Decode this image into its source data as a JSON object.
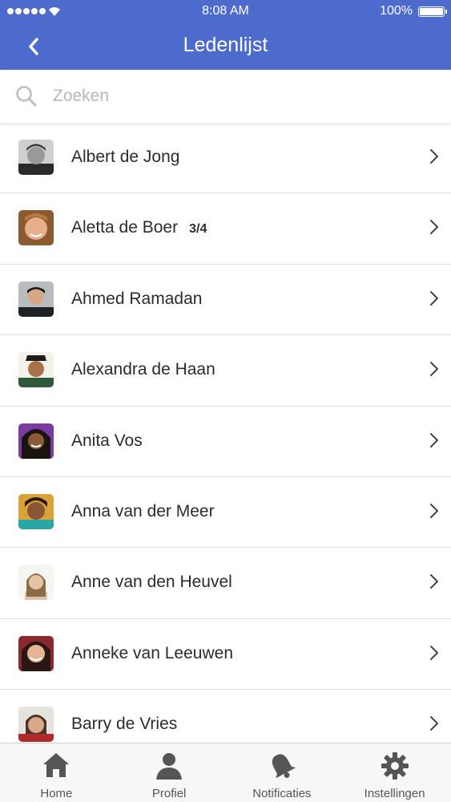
{
  "status_bar": {
    "time": "8:08 AM",
    "battery": "100%",
    "signal_icon": "signal-dots-icon",
    "wifi_icon": "wifi-icon",
    "battery_icon": "battery-icon"
  },
  "nav": {
    "title": "Ledenlijst",
    "back_icon": "chevron-left-icon",
    "background_color": "#4d6bcd"
  },
  "search": {
    "placeholder": "Zoeken",
    "value": "",
    "icon": "search-icon"
  },
  "members": [
    {
      "name": "Albert de Jong",
      "badge": ""
    },
    {
      "name": "Aletta de Boer",
      "badge": "3/4"
    },
    {
      "name": "Ahmed Ramadan",
      "badge": ""
    },
    {
      "name": "Alexandra de Haan",
      "badge": ""
    },
    {
      "name": "Anita Vos",
      "badge": ""
    },
    {
      "name": "Anna van der Meer",
      "badge": ""
    },
    {
      "name": "Anne van den Heuvel",
      "badge": ""
    },
    {
      "name": "Anneke van Leeuwen",
      "badge": ""
    },
    {
      "name": "Barry de Vries",
      "badge": ""
    }
  ],
  "tabs": [
    {
      "label": "Home",
      "icon": "home-icon"
    },
    {
      "label": "Profiel",
      "icon": "person-icon"
    },
    {
      "label": "Notificaties",
      "icon": "bell-icon"
    },
    {
      "label": "Instellingen",
      "icon": "gear-icon"
    }
  ]
}
